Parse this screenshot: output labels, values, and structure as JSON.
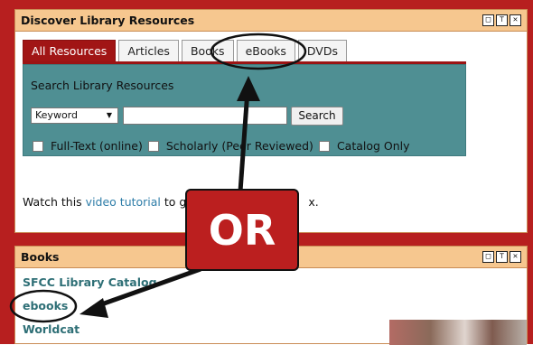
{
  "top_panel": {
    "title": "Discover Library Resources",
    "tabs": [
      "All Resources",
      "Articles",
      "Books",
      "eBooks",
      "DVDs"
    ],
    "search": {
      "heading": "Search Library Resources",
      "select_value": "Keyword",
      "input_value": "",
      "button_label": "Search"
    },
    "checkboxes": [
      "Full-Text (online)",
      "Scholarly (Peer Reviewed)",
      "Catalog Only"
    ],
    "tutorial": {
      "prefix": "Watch this ",
      "link": "video tutorial",
      "suffix": " to g",
      "tail": "x."
    }
  },
  "bottom_panel": {
    "title": "Books",
    "links": [
      "SFCC Library Catalog",
      "ebooks",
      "Worldcat"
    ]
  },
  "overlay": {
    "label": "OR"
  },
  "colors": {
    "frame": "#b71f1f",
    "header": "#f6c78f",
    "active_tab": "#a11515",
    "search_box": "#4f8f93",
    "link": "#2e6f76"
  }
}
